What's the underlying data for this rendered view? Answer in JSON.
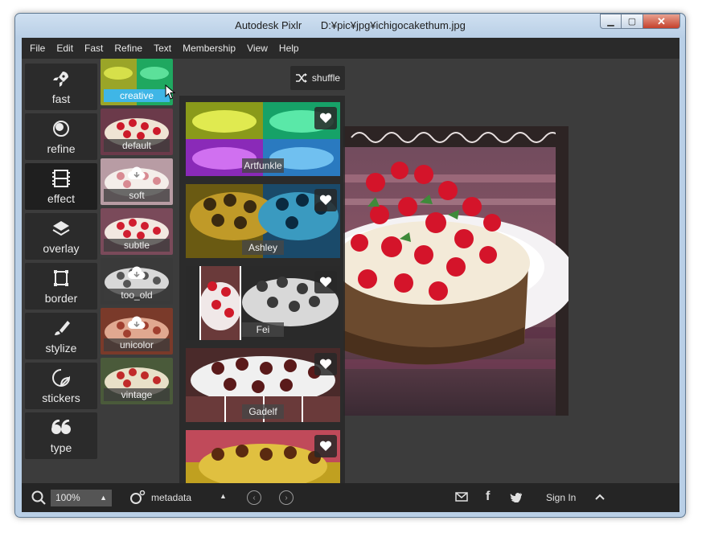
{
  "window": {
    "app_name": "Autodesk Pixlr",
    "file_path": "D:¥pic¥jpg¥ichigocakethum.jpg",
    "controls": [
      "minimize",
      "maximize",
      "close"
    ]
  },
  "menu": [
    "File",
    "Edit",
    "Fast",
    "Refine",
    "Text",
    "Membership",
    "View",
    "Help"
  ],
  "tools": [
    {
      "label": "fast",
      "icon": "rocket-icon"
    },
    {
      "label": "refine",
      "icon": "circles-icon"
    },
    {
      "label": "effect",
      "icon": "film-icon",
      "active": true
    },
    {
      "label": "overlay",
      "icon": "layers-icon"
    },
    {
      "label": "border",
      "icon": "border-frame-icon"
    },
    {
      "label": "stylize",
      "icon": "brush-icon"
    },
    {
      "label": "stickers",
      "icon": "sticker-icon"
    },
    {
      "label": "type",
      "icon": "quote-icon"
    }
  ],
  "categories": [
    {
      "label": "creative",
      "selected": true
    },
    {
      "label": "default"
    },
    {
      "label": "soft",
      "download": true
    },
    {
      "label": "subtle"
    },
    {
      "label": "too_old",
      "download": true
    },
    {
      "label": "unicolor",
      "download": true
    },
    {
      "label": "vintage"
    }
  ],
  "shuffle_label": "shuffle",
  "effects": [
    {
      "label": "Artfunkle"
    },
    {
      "label": "Ashley"
    },
    {
      "label": "Fei"
    },
    {
      "label": "Gadelf"
    },
    {
      "label": ""
    }
  ],
  "status": {
    "zoom": "100%",
    "metadata": "metadata",
    "sign_in": "Sign In"
  },
  "colors": {
    "accent": "#3fb6e6",
    "panel": "#2b2b2b",
    "background": "#3c3c3c"
  }
}
